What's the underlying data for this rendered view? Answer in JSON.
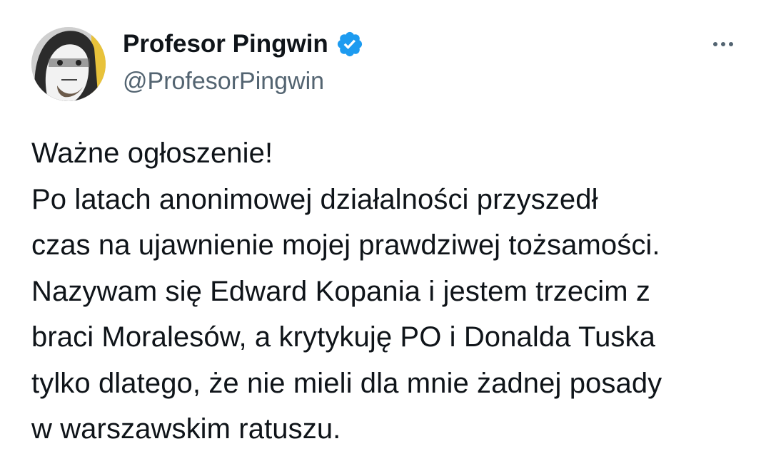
{
  "tweet": {
    "author": {
      "display_name": "Profesor Pingwin",
      "handle": "@ProfesorPingwin",
      "verified": true,
      "avatar": "avatar-masked-face"
    },
    "more_icon": "more-horizontal-icon",
    "verified_icon": "verified-badge-icon",
    "verified_color": "#1d9bf0",
    "text_lines": [
      "Ważne ogłoszenie!",
      "Po latach anonimowej działalności przyszedł",
      "czas na ujawnienie mojej prawdziwej tożsamości.",
      "Nazywam się Edward Kopania i jestem trzecim z",
      "braci Moralesów, a krytykuję PO i Donalda Tuska",
      "tylko dlatego, że nie mieli dla mnie żadnej posady",
      "w warszawskim ratuszu."
    ]
  }
}
